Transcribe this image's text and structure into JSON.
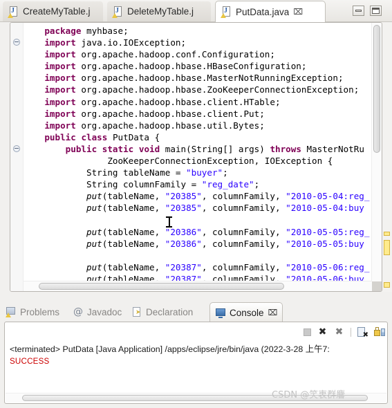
{
  "editor": {
    "tabs": [
      {
        "label": "CreateMyTable.j",
        "icon": "java-file-warning-icon",
        "active": false,
        "close": ""
      },
      {
        "label": "DeleteMyTable.j",
        "icon": "java-file-warning-icon",
        "active": false,
        "close": ""
      },
      {
        "label": "PutData.java",
        "icon": "java-file-warning-icon",
        "active": true,
        "close": "⌧"
      }
    ],
    "window_controls": {
      "minimize": "minimize-icon",
      "maximize": "maximize-icon"
    },
    "code": "    package myhbase;\n    import java.io.IOException;\n    import org.apache.hadoop.conf.Configuration;\n    import org.apache.hadoop.hbase.HBaseConfiguration;\n    import org.apache.hadoop.hbase.MasterNotRunningException;\n    import org.apache.hadoop.hbase.ZooKeeperConnectionException;\n    import org.apache.hadoop.hbase.client.HTable;\n    import org.apache.hadoop.hbase.client.Put;\n    import org.apache.hadoop.hbase.util.Bytes;\n    public class PutData {\n        public static void main(String[] args) throws MasterNotRu\n                ZooKeeperConnectionException, IOException {\n            String tableName = \"buyer\";\n            String columnFamily = \"reg_date\";\n            put(tableName, \"20385\", columnFamily, \"2010-05-04:reg_\n            put(tableName, \"20385\", columnFamily, \"2010-05-04:buy\n\n            put(tableName, \"20386\", columnFamily, \"2010-05-05:reg_\n            put(tableName, \"20386\", columnFamily, \"2010-05-05:buy\n\n            put(tableName, \"20387\", columnFamily, \"2010-05-06:reg_\n            put(tableName, \"20387\", columnFamily, \"2010-05-06:buy",
    "code_lines": [
      {
        "indent": 4,
        "tokens": [
          {
            "t": "package",
            "c": "kw"
          },
          {
            "t": " myhbase;",
            "c": ""
          }
        ]
      },
      {
        "indent": 4,
        "fold": true,
        "tokens": [
          {
            "t": "import",
            "c": "kw"
          },
          {
            "t": " java.io.IOException;",
            "c": ""
          }
        ]
      },
      {
        "indent": 4,
        "tokens": [
          {
            "t": "import",
            "c": "kw"
          },
          {
            "t": " org.apache.hadoop.conf.Configuration;",
            "c": ""
          }
        ]
      },
      {
        "indent": 4,
        "tokens": [
          {
            "t": "import",
            "c": "kw"
          },
          {
            "t": " org.apache.hadoop.hbase.HBaseConfiguration;",
            "c": ""
          }
        ]
      },
      {
        "indent": 4,
        "tokens": [
          {
            "t": "import",
            "c": "kw"
          },
          {
            "t": " org.apache.hadoop.hbase.MasterNotRunningException;",
            "c": ""
          }
        ]
      },
      {
        "indent": 4,
        "tokens": [
          {
            "t": "import",
            "c": "kw"
          },
          {
            "t": " org.apache.hadoop.hbase.ZooKeeperConnectionException;",
            "c": ""
          }
        ]
      },
      {
        "indent": 4,
        "tokens": [
          {
            "t": "import",
            "c": "kw"
          },
          {
            "t": " org.apache.hadoop.hbase.client.HTable;",
            "c": ""
          }
        ]
      },
      {
        "indent": 4,
        "tokens": [
          {
            "t": "import",
            "c": "kw"
          },
          {
            "t": " org.apache.hadoop.hbase.client.Put;",
            "c": ""
          }
        ]
      },
      {
        "indent": 4,
        "tokens": [
          {
            "t": "import",
            "c": "kw"
          },
          {
            "t": " org.apache.hadoop.hbase.util.Bytes;",
            "c": ""
          }
        ]
      },
      {
        "indent": 4,
        "tokens": [
          {
            "t": "public",
            "c": "kw"
          },
          {
            "t": " ",
            "c": ""
          },
          {
            "t": "class",
            "c": "kw"
          },
          {
            "t": " PutData {",
            "c": ""
          }
        ]
      },
      {
        "indent": 8,
        "fold": true,
        "tokens": [
          {
            "t": "public",
            "c": "kw"
          },
          {
            "t": " ",
            "c": ""
          },
          {
            "t": "static",
            "c": "kw"
          },
          {
            "t": " ",
            "c": ""
          },
          {
            "t": "void",
            "c": "kw"
          },
          {
            "t": " main(String[] args) ",
            "c": ""
          },
          {
            "t": "throws",
            "c": "kw"
          },
          {
            "t": " MasterNotRu",
            "c": ""
          }
        ]
      },
      {
        "indent": 16,
        "tokens": [
          {
            "t": "ZooKeeperConnectionException, IOException {",
            "c": ""
          }
        ]
      },
      {
        "indent": 12,
        "tokens": [
          {
            "t": "String tableName = ",
            "c": ""
          },
          {
            "t": "\"buyer\"",
            "c": "str"
          },
          {
            "t": ";",
            "c": ""
          }
        ]
      },
      {
        "indent": 12,
        "tokens": [
          {
            "t": "String columnFamily = ",
            "c": ""
          },
          {
            "t": "\"reg_date\"",
            "c": "str"
          },
          {
            "t": ";",
            "c": ""
          }
        ]
      },
      {
        "indent": 12,
        "tokens": [
          {
            "t": "put",
            "c": "mth"
          },
          {
            "t": "(tableName, ",
            "c": ""
          },
          {
            "t": "\"20385\"",
            "c": "str"
          },
          {
            "t": ", columnFamily, ",
            "c": ""
          },
          {
            "t": "\"2010-05-04:reg_",
            "c": "str"
          }
        ]
      },
      {
        "indent": 12,
        "tokens": [
          {
            "t": "put",
            "c": "mth"
          },
          {
            "t": "(tableName, ",
            "c": ""
          },
          {
            "t": "\"20385\"",
            "c": "str"
          },
          {
            "t": ", columnFamily, ",
            "c": ""
          },
          {
            "t": "\"2010-05-04:buy",
            "c": "str"
          }
        ]
      },
      {
        "indent": 0,
        "tokens": []
      },
      {
        "indent": 12,
        "tokens": [
          {
            "t": "put",
            "c": "mth"
          },
          {
            "t": "(tableName, ",
            "c": ""
          },
          {
            "t": "\"20386\"",
            "c": "str"
          },
          {
            "t": ", columnFamily, ",
            "c": ""
          },
          {
            "t": "\"2010-05-05:reg_",
            "c": "str"
          }
        ]
      },
      {
        "indent": 12,
        "tokens": [
          {
            "t": "put",
            "c": "mth"
          },
          {
            "t": "(tableName, ",
            "c": ""
          },
          {
            "t": "\"20386\"",
            "c": "str"
          },
          {
            "t": ", columnFamily, ",
            "c": ""
          },
          {
            "t": "\"2010-05-05:buy",
            "c": "str"
          }
        ]
      },
      {
        "indent": 0,
        "tokens": []
      },
      {
        "indent": 12,
        "tokens": [
          {
            "t": "put",
            "c": "mth"
          },
          {
            "t": "(tableName, ",
            "c": ""
          },
          {
            "t": "\"20387\"",
            "c": "str"
          },
          {
            "t": ", columnFamily, ",
            "c": ""
          },
          {
            "t": "\"2010-05-06:reg_",
            "c": "str"
          }
        ]
      },
      {
        "indent": 12,
        "tokens": [
          {
            "t": "put",
            "c": "mth"
          },
          {
            "t": "(tableName, ",
            "c": ""
          },
          {
            "t": "\"20387\"",
            "c": "str"
          },
          {
            "t": ", columnFamily, ",
            "c": ""
          },
          {
            "t": "\"2010-05-06:buy",
            "c": "str"
          }
        ]
      }
    ],
    "colors": {
      "keyword": "#7f0055",
      "string": "#2a00ff",
      "plain": "#000000",
      "annotation_marker": "#ffeb8c"
    }
  },
  "console": {
    "tabs": [
      {
        "label": "Problems",
        "icon": "problems-icon",
        "active": false
      },
      {
        "label": "Javadoc",
        "icon": "javadoc-icon",
        "active": false
      },
      {
        "label": "Declaration",
        "icon": "declaration-icon",
        "active": false
      },
      {
        "label": "Console",
        "icon": "console-icon",
        "active": true,
        "close": "⌧"
      }
    ],
    "toolbar": [
      {
        "name": "terminate-icon"
      },
      {
        "name": "remove-launch-icon",
        "glyph": "✖"
      },
      {
        "name": "remove-all-launches-icon",
        "glyph": "✖"
      },
      {
        "name": "clear-console-icon"
      },
      {
        "name": "scroll-lock-icon"
      }
    ],
    "terminated_line": "<terminated> PutData [Java Application] /apps/eclipse/jre/bin/java (2022-3-28 上午7:",
    "output": "SUCCESS",
    "output_color": "#cc0000"
  },
  "watermark": "CSDN @笑衷群麘"
}
